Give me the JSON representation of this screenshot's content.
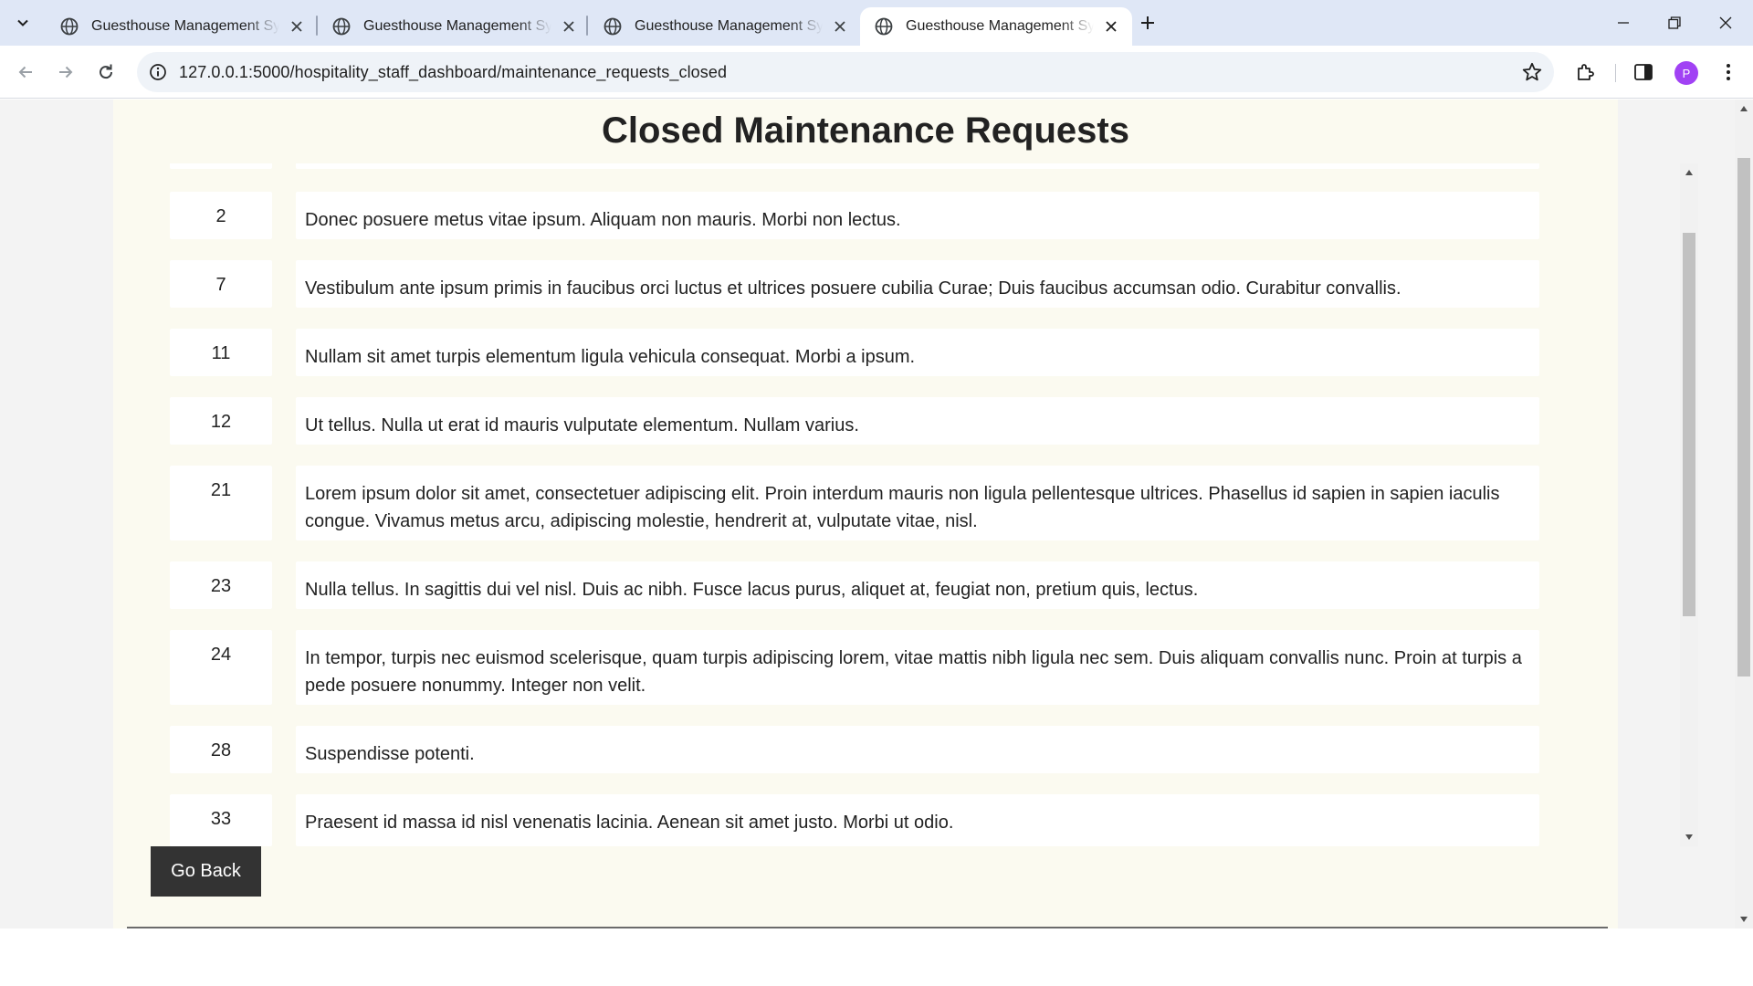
{
  "browser": {
    "tabs": [
      {
        "title": "Guesthouse Management System",
        "active": false
      },
      {
        "title": "Guesthouse Management System",
        "active": false
      },
      {
        "title": "Guesthouse Management System",
        "active": false
      },
      {
        "title": "Guesthouse Management System",
        "active": true
      }
    ],
    "url": "127.0.0.1:5000/hospitality_staff_dashboard/maintenance_requests_closed",
    "profile_initial": "P",
    "profile_color": "#a142f4"
  },
  "page": {
    "title": "Closed Maintenance Requests",
    "go_back_label": "Go Back",
    "requests": [
      {
        "id": "2",
        "description": "Donec posuere metus vitae ipsum. Aliquam non mauris. Morbi non lectus."
      },
      {
        "id": "7",
        "description": "Vestibulum ante ipsum primis in faucibus orci luctus et ultrices posuere cubilia Curae; Duis faucibus accumsan odio. Curabitur convallis."
      },
      {
        "id": "11",
        "description": "Nullam sit amet turpis elementum ligula vehicula consequat. Morbi a ipsum."
      },
      {
        "id": "12",
        "description": "Ut tellus. Nulla ut erat id mauris vulputate elementum. Nullam varius."
      },
      {
        "id": "21",
        "description": "Lorem ipsum dolor sit amet, consectetuer adipiscing elit. Proin interdum mauris non ligula pellentesque ultrices. Phasellus id sapien in sapien iaculis congue. Vivamus metus arcu, adipiscing molestie, hendrerit at, vulputate vitae, nisl."
      },
      {
        "id": "23",
        "description": "Nulla tellus. In sagittis dui vel nisl. Duis ac nibh. Fusce lacus purus, aliquet at, feugiat non, pretium quis, lectus."
      },
      {
        "id": "24",
        "description": "In tempor, turpis nec euismod scelerisque, quam turpis adipiscing lorem, vitae mattis nibh ligula nec sem. Duis aliquam convallis nunc. Proin at turpis a pede posuere nonummy. Integer non velit."
      },
      {
        "id": "28",
        "description": "Suspendisse potenti."
      },
      {
        "id": "33",
        "description": "Praesent id massa id nisl venenatis lacinia. Aenean sit amet justo. Morbi ut odio."
      }
    ]
  }
}
